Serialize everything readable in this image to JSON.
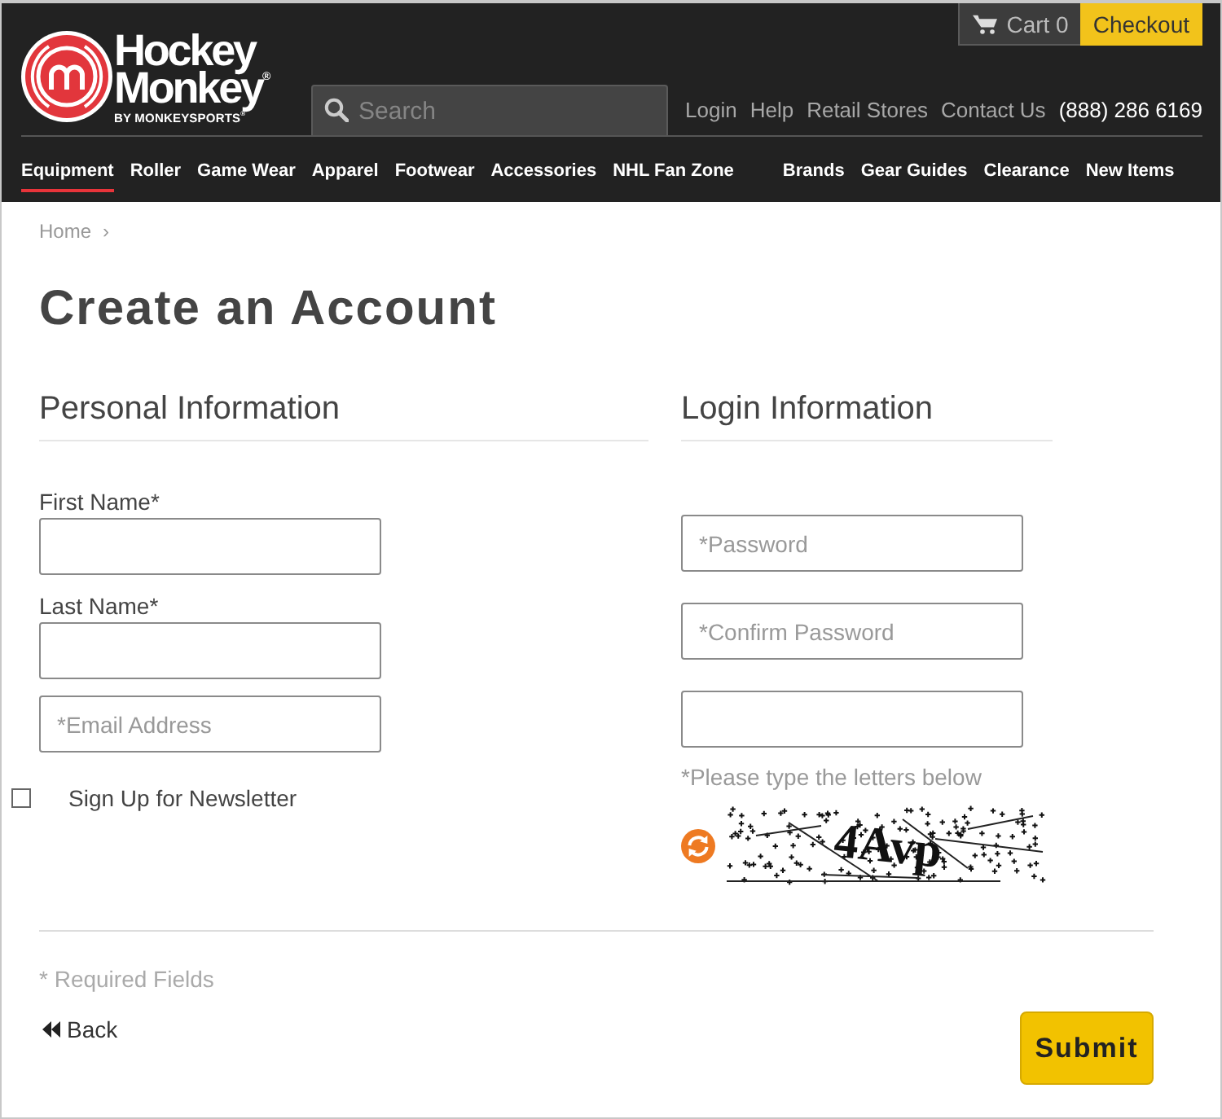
{
  "header": {
    "logo": {
      "name": [
        "Hockey",
        "Monkey$^{®}$"
      ],
      "tagline": "BY MONKEYSPORTS$^{®}$"
    },
    "cart": {
      "label": "Cart 0",
      "checkout": "Checkout"
    },
    "search": {
      "placeholder": "Search"
    },
    "links": [
      {
        "label": "Login",
        "kind": "link"
      },
      {
        "label": "Help",
        "kind": "link"
      },
      {
        "label": "Retail Stores",
        "kind": "link"
      },
      {
        "label": "Contact Us",
        "kind": "link"
      },
      {
        "label": "(888) 286 6169",
        "kind": "phone"
      }
    ],
    "nav": {
      "categories": [
        {
          "label": "Equipment",
          "selected": true
        },
        {
          "label": "Roller",
          "selected": false
        },
        {
          "label": "Game Wear",
          "selected": false
        },
        {
          "label": "Apparel",
          "selected": false
        },
        {
          "label": "Footwear",
          "selected": false
        },
        {
          "label": "Accessories",
          "selected": false
        },
        {
          "label": "NHL Fan Zone",
          "selected": false
        }
      ],
      "links": [
        {
          "label": "Brands",
          "selected": false
        },
        {
          "label": "Gear Guides",
          "selected": false
        },
        {
          "label": "Clearance",
          "selected": false
        },
        {
          "label": "New Items",
          "selected": false
        }
      ]
    }
  },
  "breadcrumb": {
    "items": [
      "Home"
    ],
    "separator": "›"
  },
  "title": "Create an Account",
  "personal": {
    "heading": "Personal Information",
    "fields": [
      {
        "label": "First Name*"
      },
      {
        "label": "Last Name*"
      },
      {
        "placeholder": "*Email Address"
      }
    ],
    "newsletter": {
      "label": "Sign Up for Newsletter",
      "checked": false
    }
  },
  "login": {
    "heading": "Login Information",
    "fields": [
      {
        "placeholder": "*Password"
      },
      {
        "placeholder": "*Confirm Password"
      }
    ],
    "captcha": {
      "hint": "*Please type the letters below",
      "code": "4Avp"
    }
  },
  "footer": {
    "note": "* Required Fields",
    "back": "Back",
    "submit": "Submit"
  }
}
